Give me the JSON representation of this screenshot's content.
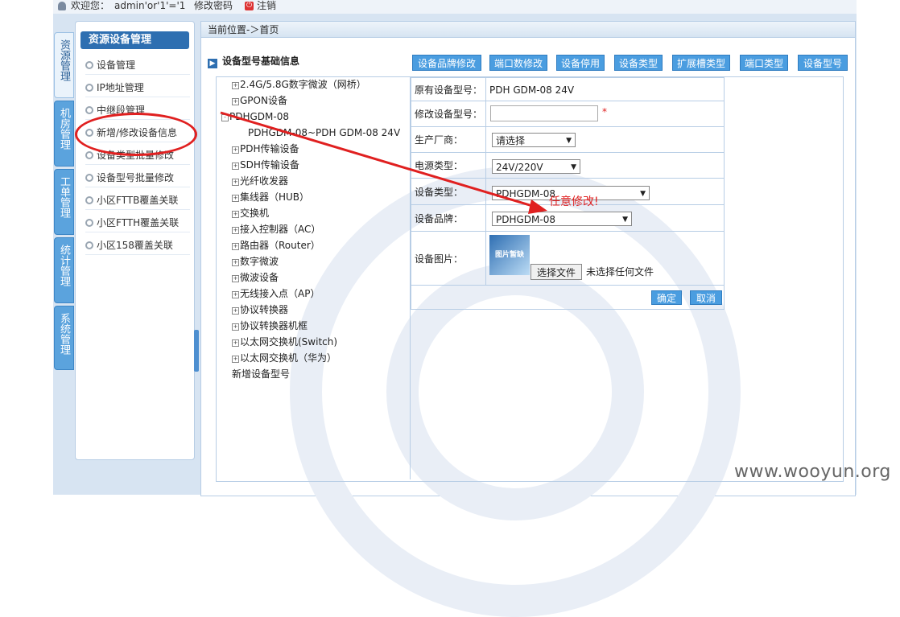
{
  "topbar": {
    "welcome": "欢迎您：",
    "user": "admin'or'1'='1",
    "change_password": "修改密码",
    "logout": "注销",
    "logout_icon": "power-icon"
  },
  "vtabs": [
    "资源管理",
    "机房管理",
    "工单管理",
    "统计管理",
    "系统管理"
  ],
  "left_panel": {
    "title": "资源设备管理",
    "items": [
      "设备管理",
      "IP地址管理",
      "中继段管理",
      "新增/修改设备信息",
      "设备类型批量修改",
      "设备型号批量修改",
      "小区FTTB覆盖关联",
      "小区FTTH覆盖关联",
      "小区158覆盖关联"
    ]
  },
  "breadcrumb": "当前位置-＞首页",
  "section_title": "设备型号基础信息",
  "toolbar": [
    "设备品牌修改",
    "端口数修改",
    "设备停用",
    "设备类型",
    "扩展槽类型",
    "端口类型",
    "设备型号"
  ],
  "tree": {
    "items": [
      {
        "label": "2.4G/5.8G数字微波（网桥）",
        "sign": "+"
      },
      {
        "label": "GPON设备",
        "sign": "+"
      },
      {
        "label": "PDHGDM-08",
        "sign": "-"
      },
      {
        "label": "PDHGDM-08~PDH GDM-08 24V",
        "sign": ""
      },
      {
        "label": "PDH传输设备",
        "sign": "+"
      },
      {
        "label": "SDH传输设备",
        "sign": "+"
      },
      {
        "label": "光纤收发器",
        "sign": "+"
      },
      {
        "label": "集线器（HUB）",
        "sign": "+"
      },
      {
        "label": "交换机",
        "sign": "+"
      },
      {
        "label": "接入控制器（AC）",
        "sign": "+"
      },
      {
        "label": "路由器（Router）",
        "sign": "+"
      },
      {
        "label": "数字微波",
        "sign": "+"
      },
      {
        "label": "微波设备",
        "sign": "+"
      },
      {
        "label": "无线接入点（AP）",
        "sign": "+"
      },
      {
        "label": "协议转换器",
        "sign": "+"
      },
      {
        "label": "协议转换器机框",
        "sign": "+"
      },
      {
        "label": "以太网交换机(Switch)",
        "sign": "+"
      },
      {
        "label": "以太网交换机（华为）",
        "sign": "+"
      },
      {
        "label": "新增设备型号",
        "sign": ""
      }
    ]
  },
  "form": {
    "original_label": "原有设备型号：",
    "original_value": "PDH GDM-08 24V",
    "modify_label": "修改设备型号：",
    "required_mark": "*",
    "vendor_label": "生产厂商：",
    "vendor_value": "请选择",
    "power_label": "电源类型：",
    "power_value": "24V/220V",
    "type_label": "设备类型：",
    "type_value": "PDHGDM-08",
    "brand_label": "设备品牌：",
    "brand_value": "PDHGDM-08",
    "image_label": "设备图片：",
    "image_caption": "图片暂缺",
    "choose_file": "选择文件",
    "no_file": "未选择任何文件",
    "confirm": "确定",
    "cancel": "取消"
  },
  "annotation": "任意修改!",
  "watermark": "www.wooyun.org",
  "colors": {
    "accent": "#4a9de0",
    "annotation": "#e02020",
    "title": "#2e6fb1"
  }
}
